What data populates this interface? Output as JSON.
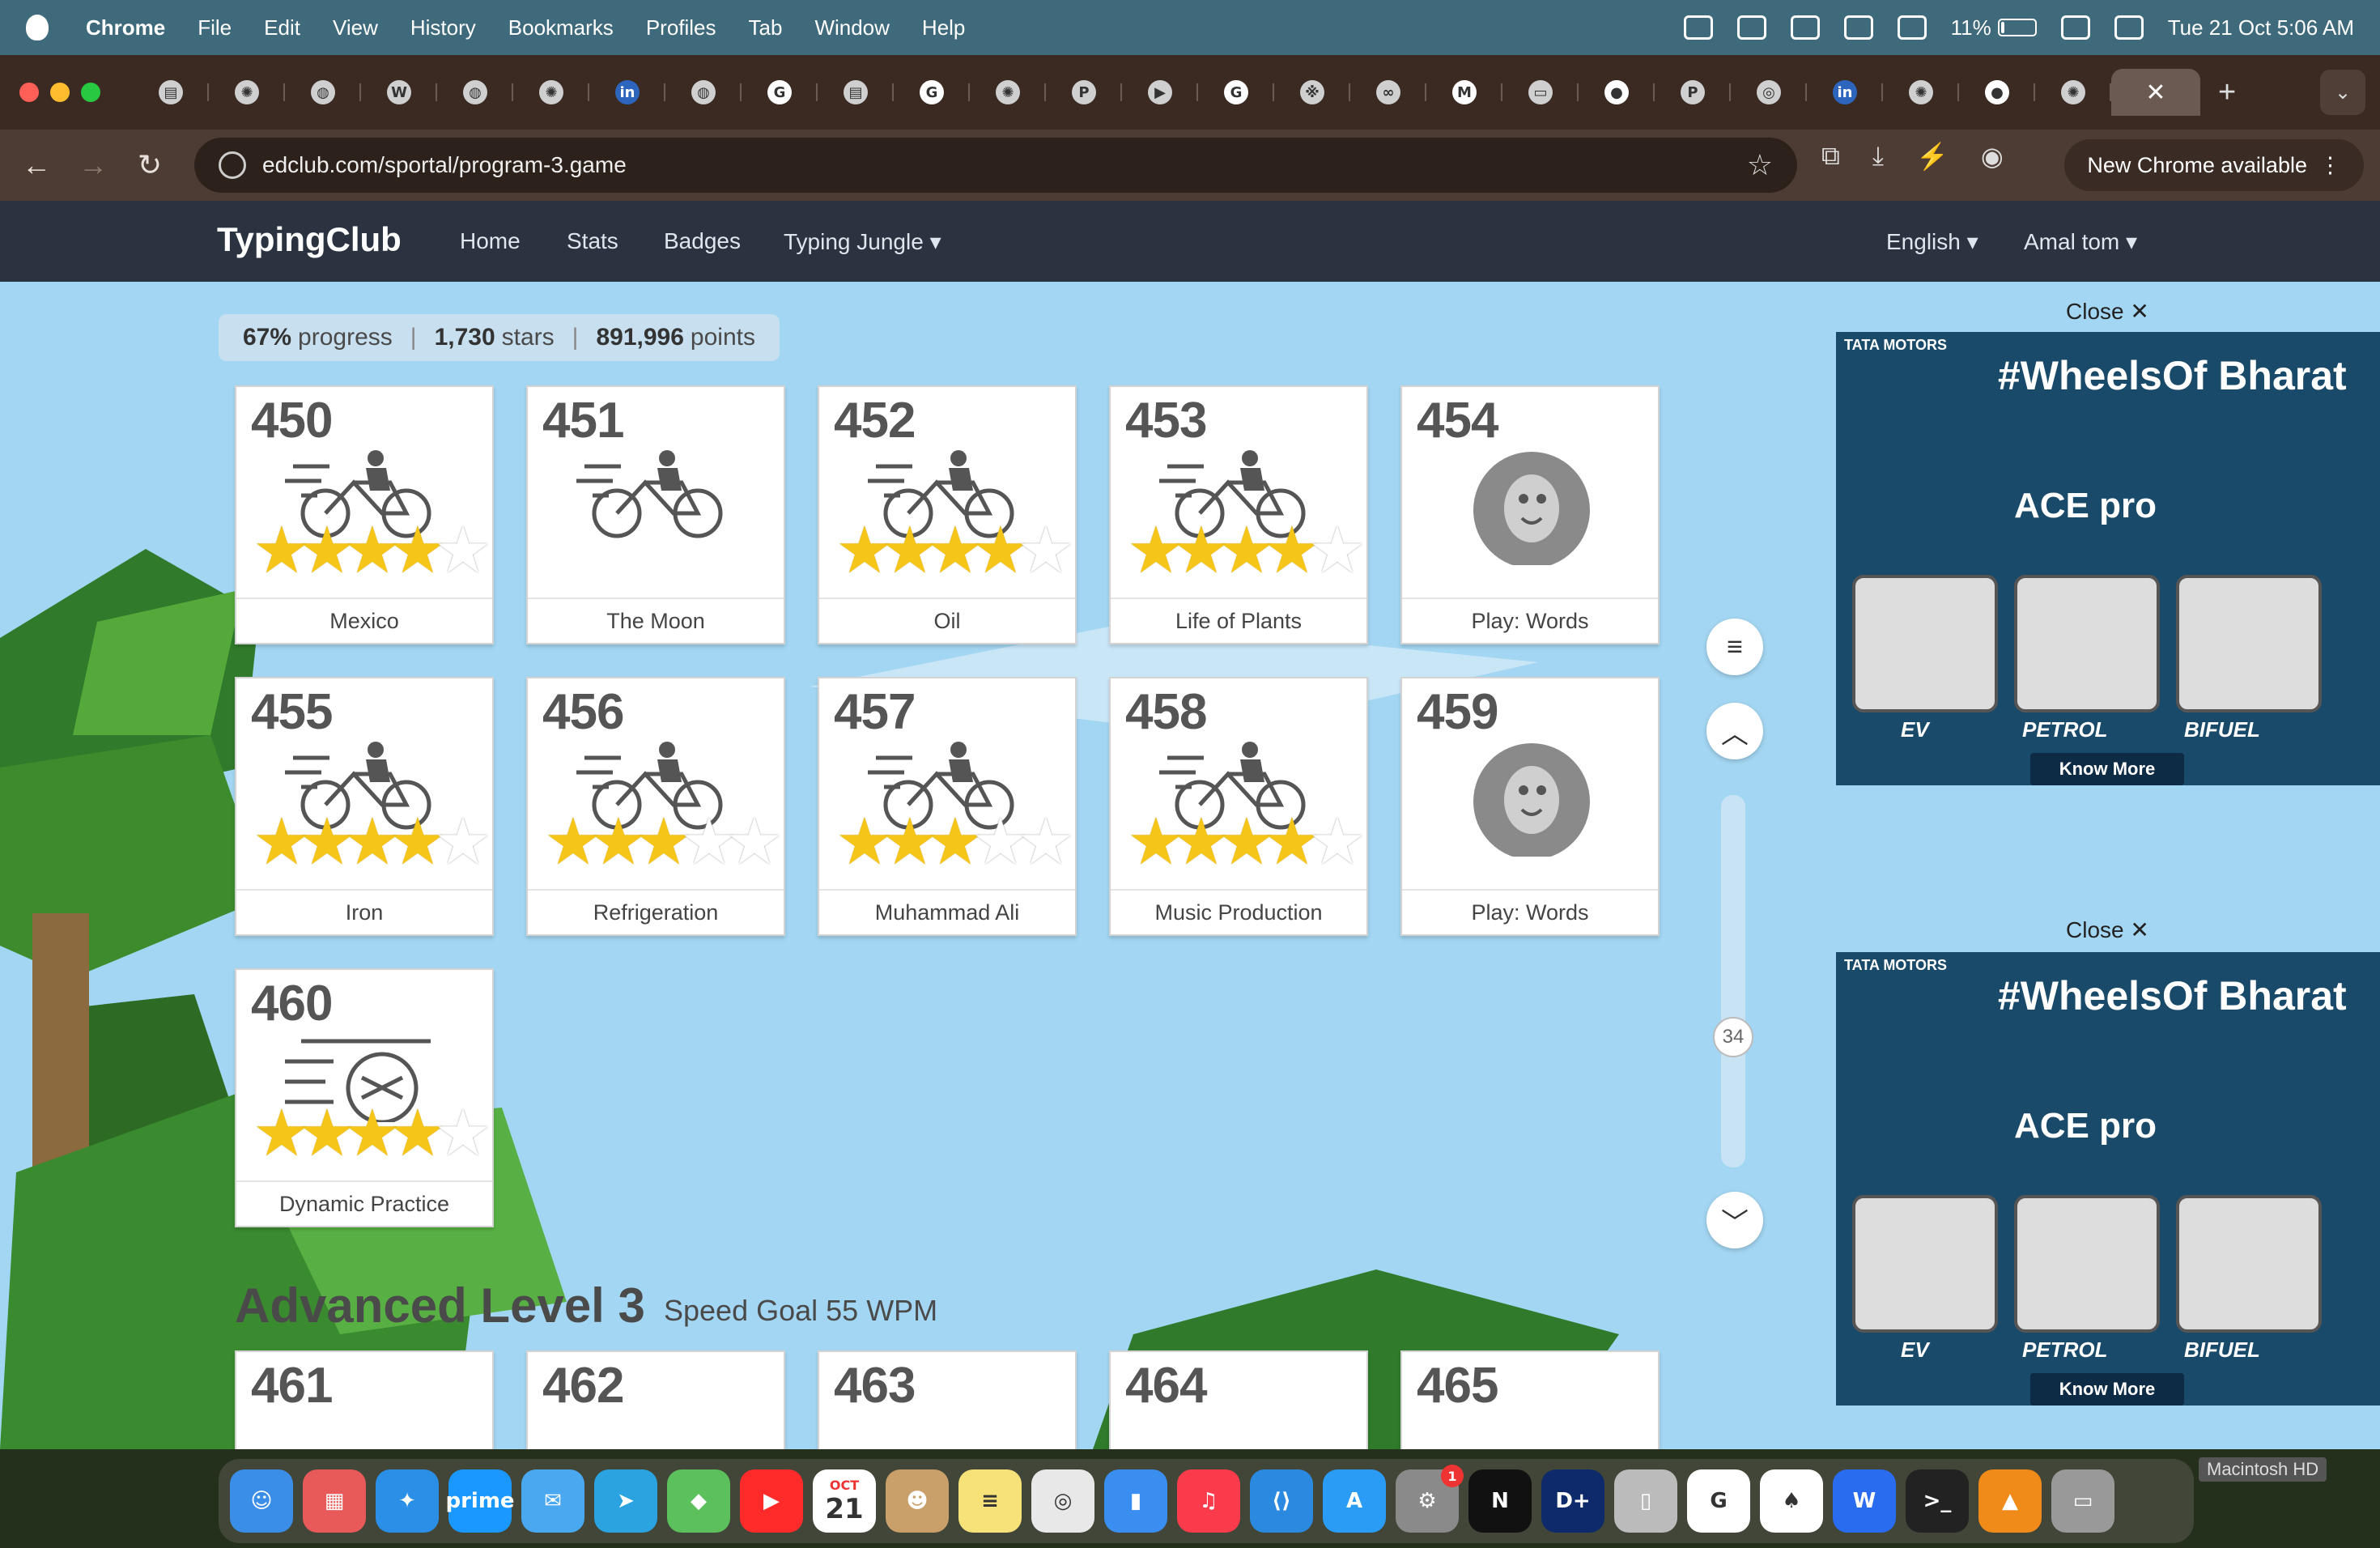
{
  "menubar": {
    "app": "Chrome",
    "items": [
      "File",
      "Edit",
      "View",
      "History",
      "Bookmarks",
      "Profiles",
      "Tab",
      "Window",
      "Help"
    ],
    "battery": "11%",
    "clock": "Tue 21 Oct  5:06 AM"
  },
  "tabs": {
    "favicons": [
      "doc-icon",
      "chatgpt-icon",
      "globe-icon",
      "wikipedia-icon",
      "globe-icon",
      "chatgpt-icon",
      "linkedin-icon",
      "globe-icon",
      "google-icon",
      "doc-icon",
      "google-icon",
      "chatgpt-icon",
      "perplexity-icon",
      "meet-icon",
      "google-icon",
      "grid-icon",
      "meta-icon",
      "gmail-icon",
      "media-icon",
      "github-icon",
      "perplexity-icon",
      "chrome-icon",
      "linkedin-icon",
      "chatgpt-icon",
      "github-icon",
      "chatgpt-icon"
    ],
    "active_close": "✕",
    "new_tab": "+",
    "menu": "⌄"
  },
  "toolbar": {
    "url": "edclub.com/sportal/program-3.game",
    "new_chrome": "New Chrome available"
  },
  "site": {
    "brand": "TypingClub",
    "nav": [
      "Home",
      "Stats",
      "Badges",
      "Typing Jungle ▾"
    ],
    "lang": "English ▾",
    "user": "Amal tom ▾"
  },
  "progress": {
    "percent": "67%",
    "percent_label": "progress",
    "stars": "1,730",
    "stars_label": "stars",
    "points": "891,996",
    "points_label": "points"
  },
  "lessons": [
    {
      "num": "450",
      "title": "Mexico",
      "kind": "bike",
      "stars": 4
    },
    {
      "num": "451",
      "title": "The Moon",
      "kind": "bike",
      "stars": 0
    },
    {
      "num": "452",
      "title": "Oil",
      "kind": "bike",
      "stars": 4
    },
    {
      "num": "453",
      "title": "Life of Plants",
      "kind": "bike",
      "stars": 4
    },
    {
      "num": "454",
      "title": "Play: Words",
      "kind": "game",
      "stars": 0
    },
    {
      "num": "455",
      "title": "Iron",
      "kind": "bike",
      "stars": 4
    },
    {
      "num": "456",
      "title": "Refrigeration",
      "kind": "bike",
      "stars": 3
    },
    {
      "num": "457",
      "title": "Muhammad Ali",
      "kind": "bike",
      "stars": 3
    },
    {
      "num": "458",
      "title": "Music Production",
      "kind": "bike",
      "stars": 4
    },
    {
      "num": "459",
      "title": "Play: Words",
      "kind": "game",
      "stars": 0
    },
    {
      "num": "460",
      "title": "Dynamic Practice",
      "kind": "shuffle",
      "stars": 4
    }
  ],
  "section": {
    "title": "Advanced Level 3",
    "subtitle": "Speed Goal 55 WPM"
  },
  "next_lessons": [
    "461",
    "462",
    "463",
    "464",
    "465"
  ],
  "scroll": {
    "page": "34"
  },
  "ads": {
    "close": "Close ✕",
    "brand": "TATA MOTORS",
    "headline": "#WheelsOf Bharat",
    "product": "ACE pro",
    "fuels": [
      "EV",
      "PETROL",
      "BIFUEL"
    ],
    "cta": "Know More"
  },
  "dock": {
    "hd_label": "Macintosh HD",
    "calendar_month": "OCT",
    "calendar_day": "21",
    "badge": "1"
  }
}
